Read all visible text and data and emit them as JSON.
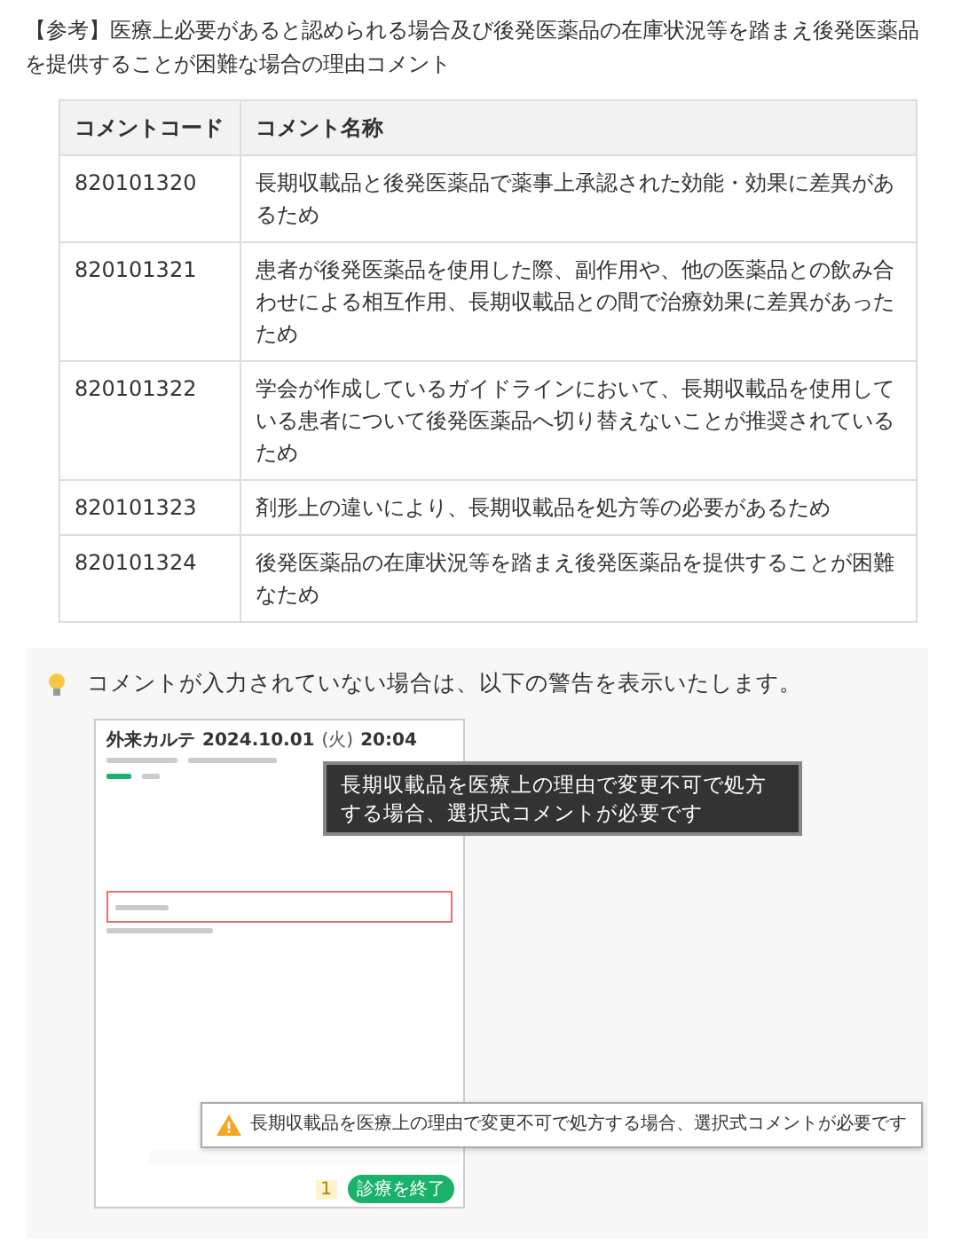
{
  "intro": "【参考】医療上必要があると認められる場合及び後発医薬品の在庫状況等を踏まえ後発医薬品を提供することが困難な場合の理由コメント",
  "table": {
    "columns": [
      "コメントコード",
      "コメント名称"
    ],
    "rows": [
      [
        "820101320",
        "長期収載品と後発医薬品で薬事上承認された効能・効果に差異があるため"
      ],
      [
        "820101321",
        "患者が後発医薬品を使用した際、副作用や、他の医薬品との飲み合わせによる相互作用、長期収載品との間で治療効果に差異があったため"
      ],
      [
        "820101322",
        "学会が作成しているガイドラインにおいて、長期収載品を使用している患者について後発医薬品へ切り替えないことが推奨されているため"
      ],
      [
        "820101323",
        "剤形上の違いにより、長期収載品を処方等の必要があるため"
      ],
      [
        "820101324",
        "後発医薬品の在庫状況等を踏まえ後発医薬品を提供することが困難なため"
      ]
    ]
  },
  "tip": {
    "text": "コメントが入力されていない場合は、以下の警告を表示いたします。"
  },
  "screenshot": {
    "title": "外来カルテ",
    "date": "2024.10.01",
    "weekday": "(火)",
    "time": "20:04",
    "warning_count": "1",
    "finish_button": "診療を終了"
  },
  "callouts": [
    {
      "kind": "dark",
      "text": "長期収載品を医療上の理由で変更不可で処方する場合、選択式コメントが必要です"
    },
    {
      "kind": "warning",
      "text": "長期収載品を医療上の理由で変更不可で処方する場合、選択式コメントが必要です"
    }
  ]
}
